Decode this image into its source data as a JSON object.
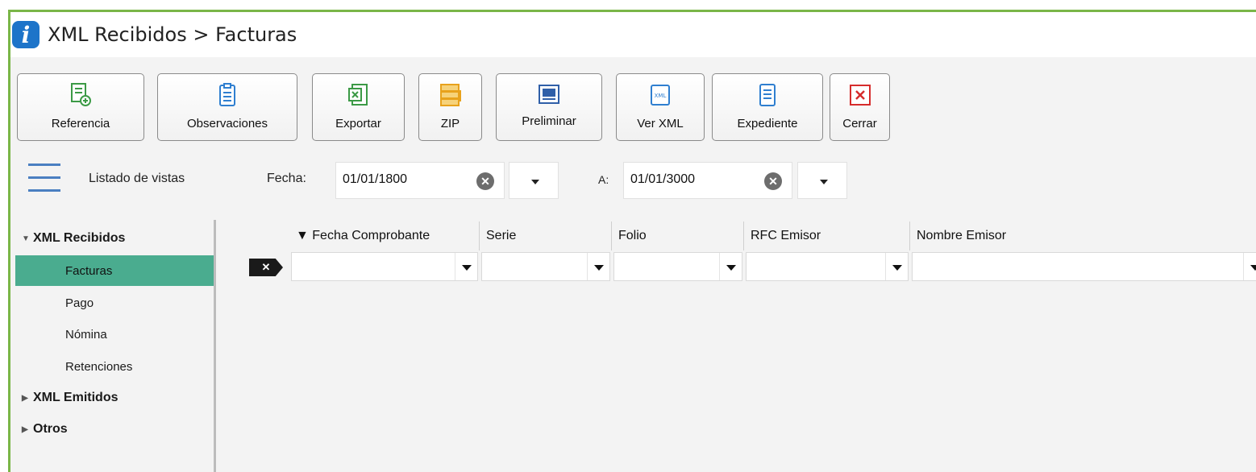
{
  "window": {
    "title": "XML Recibidos > Facturas",
    "accent": "#7ab648",
    "app_icon": "info-icon"
  },
  "toolbar": {
    "buttons": [
      {
        "label": "Referencia",
        "icon": "reference-doc-icon",
        "color": "#3c9a46"
      },
      {
        "label": "Observaciones",
        "icon": "clipboard-icon",
        "color": "#2f7fd0"
      },
      {
        "label": "Exportar",
        "icon": "excel-export-icon",
        "color": "#3c9a46"
      },
      {
        "label": "ZIP",
        "icon": "zip-stack-icon",
        "color": "#e8a21c"
      },
      {
        "label": "Preliminar",
        "icon": "preview-window-icon",
        "color": "#2f5fa8"
      },
      {
        "label": "Ver XML",
        "icon": "xml-file-icon",
        "color": "#2f7fd0"
      },
      {
        "label": "Expediente",
        "icon": "document-list-icon",
        "color": "#2f7fd0"
      },
      {
        "label": "Cerrar",
        "icon": "close-icon",
        "color": "#d62c2c"
      }
    ]
  },
  "filters": {
    "views_label": "Listado de vistas",
    "date_from_label": "Fecha:",
    "date_from_value": "01/01/1800",
    "date_to_label": "A:",
    "date_to_value": "01/01/3000"
  },
  "sidebar": {
    "groups": [
      {
        "label": "XML Recibidos",
        "expanded": true,
        "children": [
          "Facturas",
          "Pago",
          "Nómina",
          "Retenciones"
        ],
        "selected": "Facturas"
      },
      {
        "label": "XML Emitidos",
        "expanded": false
      },
      {
        "label": "Otros",
        "expanded": false
      }
    ],
    "selected_color": "#4aac8f"
  },
  "grid": {
    "columns": [
      "▼ Fecha Comprobante",
      "Serie",
      "Folio",
      "RFC Emisor",
      "Nombre Emisor"
    ],
    "clear_filter_label": "✕"
  }
}
